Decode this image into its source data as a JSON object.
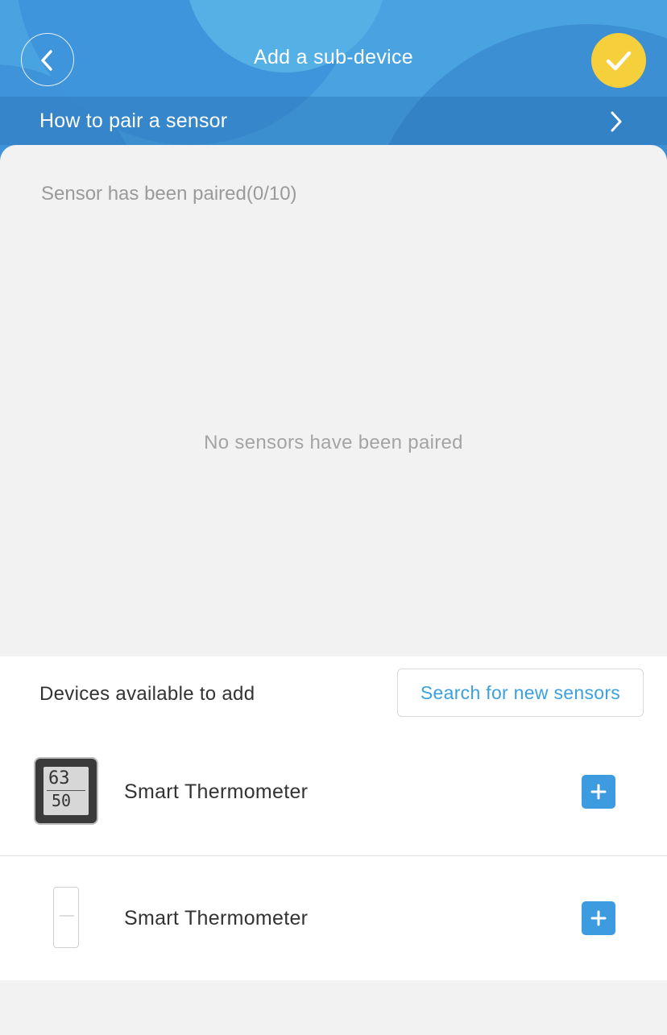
{
  "header": {
    "title": "Add a sub-device",
    "back_icon": "chevron-left-icon",
    "confirm_icon": "checkmark-icon",
    "confirm_color": "#f6cf3d",
    "background_color": "#4aa3e1"
  },
  "pair_bar": {
    "label": "How to pair a sensor",
    "icon": "chevron-right-icon"
  },
  "paired": {
    "label": "Sensor has been paired(0/10)",
    "empty_text": "No sensors have been paired"
  },
  "available": {
    "heading": "Devices available to add",
    "search_button": "Search for new sensors",
    "accent_color": "#3aa0e0",
    "devices": [
      {
        "name": "Smart Thermometer",
        "icon": "lcd-thermometer-icon",
        "display_temp": "63",
        "display_humidity": "50"
      },
      {
        "name": "Smart Thermometer",
        "icon": "slim-sensor-icon"
      }
    ]
  }
}
